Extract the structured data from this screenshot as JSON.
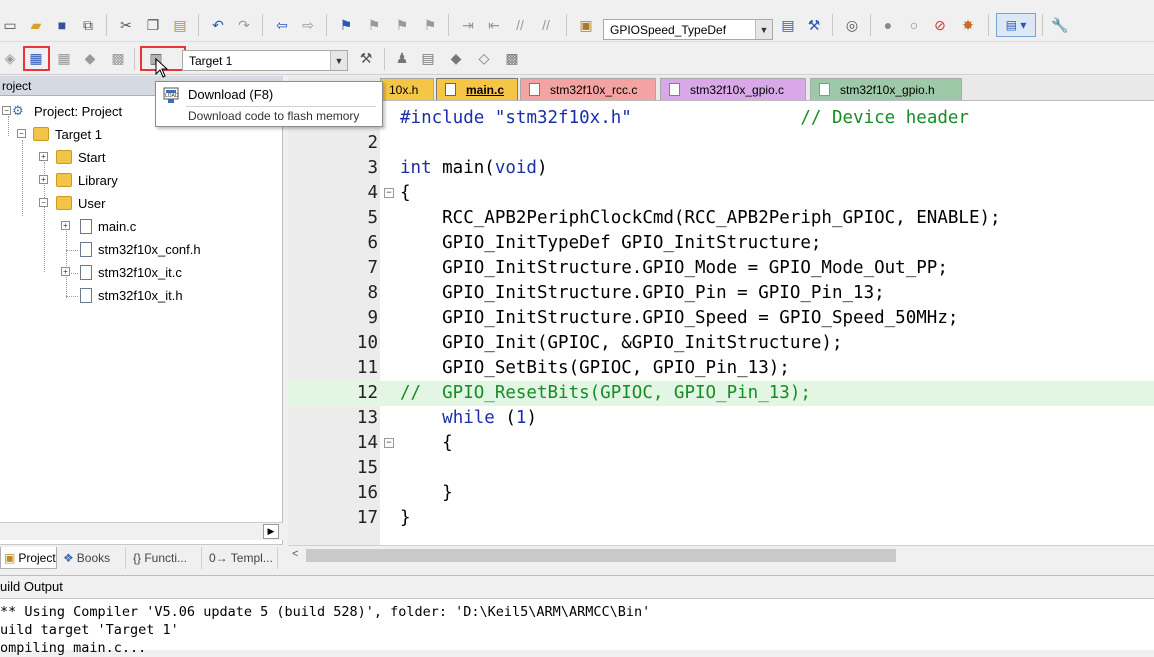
{
  "toolbar": {
    "function_combo": "GPIOSpeed_TypeDef"
  },
  "build_toolbar": {
    "target_combo": "Target 1"
  },
  "tooltip": {
    "title": "Download (F8)",
    "description": "Download code to flash memory"
  },
  "project_panel": {
    "title": "roject",
    "tree": [
      {
        "label": "Project: Project"
      },
      {
        "label": "Target 1"
      },
      {
        "label": "Start"
      },
      {
        "label": "Library"
      },
      {
        "label": "User"
      },
      {
        "label": "main.c"
      },
      {
        "label": "stm32f10x_conf.h"
      },
      {
        "label": "stm32f10x_it.c"
      },
      {
        "label": "stm32f10x_it.h"
      }
    ],
    "bottom_tabs": [
      {
        "label": "Project"
      },
      {
        "label": "Books"
      },
      {
        "label": "{} Functi..."
      },
      {
        "label": "0→ Templ..."
      }
    ]
  },
  "editor": {
    "tabs": [
      {
        "label": "10x.h",
        "color": "#f5c645"
      },
      {
        "label": "main.c",
        "color": "#f5c645"
      },
      {
        "label": "stm32f10x_rcc.c",
        "color": "#f4a3a3"
      },
      {
        "label": "stm32f10x_gpio.c",
        "color": "#d8a8e8"
      },
      {
        "label": "stm32f10x_gpio.h",
        "color": "#9ec9a8"
      }
    ],
    "active_tab": "main.c",
    "lines": [
      {
        "n": "1",
        "code": "#include \"stm32f10x.h\"                // Device header"
      },
      {
        "n": "2",
        "code": ""
      },
      {
        "n": "3",
        "code": "int main(void)"
      },
      {
        "n": "4",
        "code": "{"
      },
      {
        "n": "5",
        "code": "    RCC_APB2PeriphClockCmd(RCC_APB2Periph_GPIOC, ENABLE);"
      },
      {
        "n": "6",
        "code": "    GPIO_InitTypeDef GPIO_InitStructure;"
      },
      {
        "n": "7",
        "code": "    GPIO_InitStructure.GPIO_Mode = GPIO_Mode_Out_PP;"
      },
      {
        "n": "8",
        "code": "    GPIO_InitStructure.GPIO_Pin = GPIO_Pin_13;"
      },
      {
        "n": "9",
        "code": "    GPIO_InitStructure.GPIO_Speed = GPIO_Speed_50MHz;"
      },
      {
        "n": "10",
        "code": "    GPIO_Init(GPIOC, &GPIO_InitStructure);"
      },
      {
        "n": "11",
        "code": "    GPIO_SetBits(GPIOC, GPIO_Pin_13);"
      },
      {
        "n": "12",
        "code": "//  GPIO_ResetBits(GPIOC, GPIO_Pin_13);"
      },
      {
        "n": "13",
        "code": "    while (1)"
      },
      {
        "n": "14",
        "code": "    {"
      },
      {
        "n": "15",
        "code": ""
      },
      {
        "n": "16",
        "code": "    }"
      },
      {
        "n": "17",
        "code": "}"
      }
    ],
    "highlighted_line": "12"
  },
  "build_output": {
    "title": "uild Output",
    "lines": [
      "** Using Compiler 'V5.06 update 5 (build 528)', folder: 'D:\\Keil5\\ARM\\ARMCC\\Bin'",
      "uild target 'Target 1'",
      "ompiling main.c..."
    ]
  },
  "colors": {
    "highlight_box": "#e8353a",
    "comment": "#168d24",
    "keyword": "#1a2ea8",
    "active_line": "#e3f5e3"
  }
}
